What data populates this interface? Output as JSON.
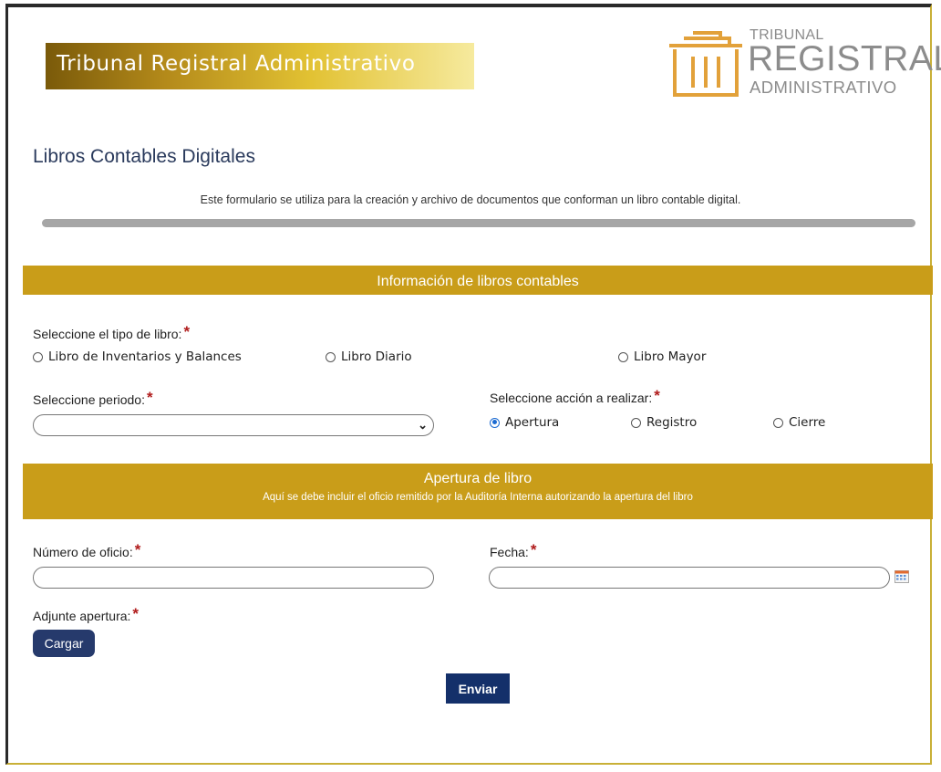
{
  "header": {
    "banner_title": "Tribunal Registral Administrativo",
    "logo_line1": "TRIBUNAL",
    "logo_line2": "REGISTRAL",
    "logo_line3": "ADMINISTRATIVO"
  },
  "page": {
    "title": "Libros Contables Digitales",
    "description": "Este formulario se utiliza para la creación y archivo de documentos que conforman un libro contable digital."
  },
  "section_info": {
    "title": "Información de libros contables",
    "tipo_libro_label": "Seleccione el tipo de libro:",
    "tipo_libro_options": [
      "Libro de Inventarios y Balances",
      "Libro Diario",
      "Libro Mayor"
    ],
    "periodo_label": "Seleccione periodo:",
    "periodo_value": "",
    "accion_label": "Seleccione acción a realizar:",
    "accion_options": [
      "Apertura",
      "Registro",
      "Cierre"
    ],
    "accion_selected": "Apertura"
  },
  "section_apertura": {
    "title": "Apertura de libro",
    "subtitle": "Aquí se debe incluir el oficio remitido por la Auditoría Interna autorizando la apertura del libro",
    "numero_oficio_label": "Número de oficio:",
    "numero_oficio_value": "",
    "fecha_label": "Fecha:",
    "fecha_value": "",
    "adjunte_label": "Adjunte apertura:",
    "cargar_label": "Cargar"
  },
  "actions": {
    "enviar_label": "Enviar"
  },
  "required_marker": "*",
  "colors": {
    "section_gold": "#c99d19",
    "button_navy": "#14306a",
    "required_red": "#b01b1b",
    "radio_blue": "#1b6ad1"
  }
}
